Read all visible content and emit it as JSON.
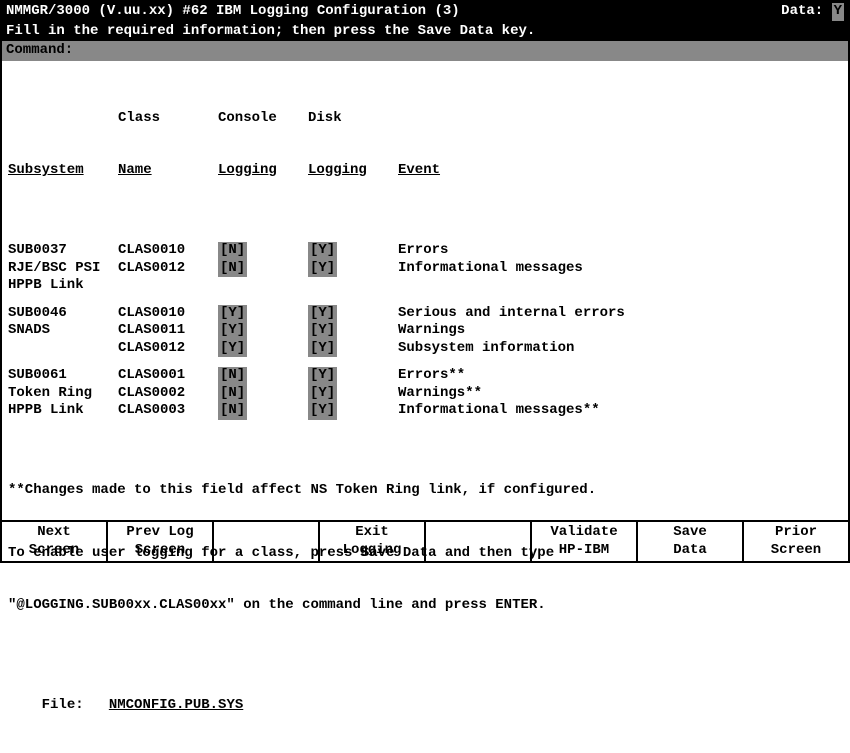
{
  "titlebar": {
    "left": "NMMGR/3000 (V.uu.xx) #62  IBM Logging Configuration (3)",
    "right_label": "Data:",
    "right_value": "Y"
  },
  "instruction": "Fill in the required information; then press the Save Data key.",
  "command_label": "Command:",
  "command_value": "",
  "headers": {
    "subsystem": "Subsystem",
    "class_top": "Class",
    "class": "Name",
    "console_top": "Console",
    "console": "Logging",
    "disk_top": "Disk",
    "disk": "Logging",
    "event": "Event"
  },
  "groups": [
    {
      "rows": [
        {
          "sub": "SUB0037",
          "cls": "CLAS0010",
          "con": "[N]",
          "dsk": "[Y]",
          "evt": "Errors"
        },
        {
          "sub": "RJE/BSC PSI",
          "cls": "CLAS0012",
          "con": "[N]",
          "dsk": "[Y]",
          "evt": "Informational messages"
        },
        {
          "sub": "HPPB Link",
          "cls": "",
          "con": "",
          "dsk": "",
          "evt": ""
        }
      ]
    },
    {
      "rows": [
        {
          "sub": "SUB0046",
          "cls": "CLAS0010",
          "con": "[Y]",
          "dsk": "[Y]",
          "evt": "Serious and internal errors"
        },
        {
          "sub": "SNADS",
          "cls": "CLAS0011",
          "con": "[Y]",
          "dsk": "[Y]",
          "evt": "Warnings"
        },
        {
          "sub": "",
          "cls": "CLAS0012",
          "con": "[Y]",
          "dsk": "[Y]",
          "evt": "Subsystem information"
        }
      ]
    },
    {
      "rows": [
        {
          "sub": "SUB0061",
          "cls": "CLAS0001",
          "con": "[N]",
          "dsk": "[Y]",
          "evt": "Errors**"
        },
        {
          "sub": "Token Ring",
          "cls": "CLAS0002",
          "con": "[N]",
          "dsk": "[Y]",
          "evt": "Warnings**"
        },
        {
          "sub": "HPPB Link",
          "cls": "CLAS0003",
          "con": "[N]",
          "dsk": "[Y]",
          "evt": "Informational messages**"
        }
      ]
    }
  ],
  "footnote": "**Changes made to this field affect NS Token Ring link, if configured.",
  "help1": "To enable user logging for a class, press Save Data and then type",
  "help2": "\"@LOGGING.SUB00xx.CLAS00xx\" on the command line and press ENTER.",
  "file_label": "File:",
  "file_value": "NMCONFIG.PUB.SYS",
  "fkeys": [
    {
      "l1": "Next",
      "l2": "Screen"
    },
    {
      "l1": "Prev Log",
      "l2": "Screen"
    },
    {
      "l1": "",
      "l2": ""
    },
    {
      "l1": "Exit",
      "l2": "Logging"
    },
    {
      "l1": "",
      "l2": ""
    },
    {
      "l1": "Validate",
      "l2": "HP-IBM"
    },
    {
      "l1": "Save",
      "l2": "Data"
    },
    {
      "l1": "Prior",
      "l2": "Screen"
    }
  ]
}
